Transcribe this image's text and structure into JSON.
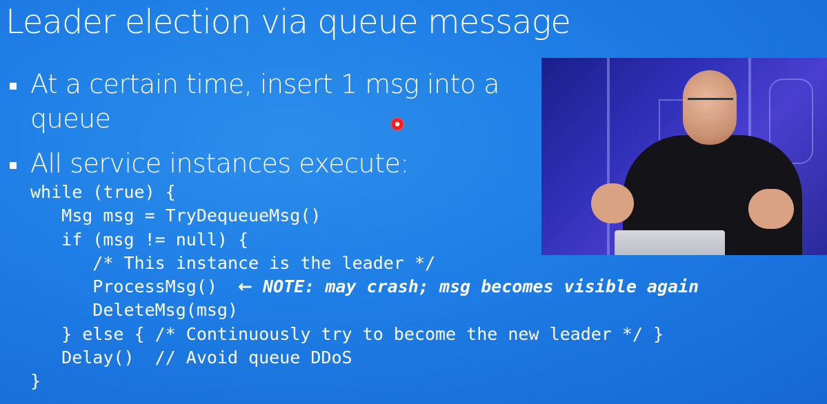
{
  "slide": {
    "title": "Leader election via queue message",
    "bullets": [
      "At a certain time, insert 1 msg into a queue",
      "All service instances execute:"
    ],
    "code_lines": [
      "while (true) {",
      "   Msg msg = TryDequeueMsg()",
      "   if (msg != null) {",
      "      /* This instance is the leader */",
      "      ProcessMsg()  ",
      "      DeleteMsg(msg)",
      "   } else { /* Continuously try to become the new leader */ }",
      "   Delay()  // Avoid queue DDoS",
      "}"
    ],
    "note_arrow": "←",
    "note_text": " NOTE: may crash; msg becomes visible again"
  },
  "video": {
    "subject": "presenter video feed"
  },
  "pointer": {
    "color": "#ff1a1a"
  },
  "colors": {
    "background": "#1f7fe6",
    "text": "#ffffff"
  }
}
